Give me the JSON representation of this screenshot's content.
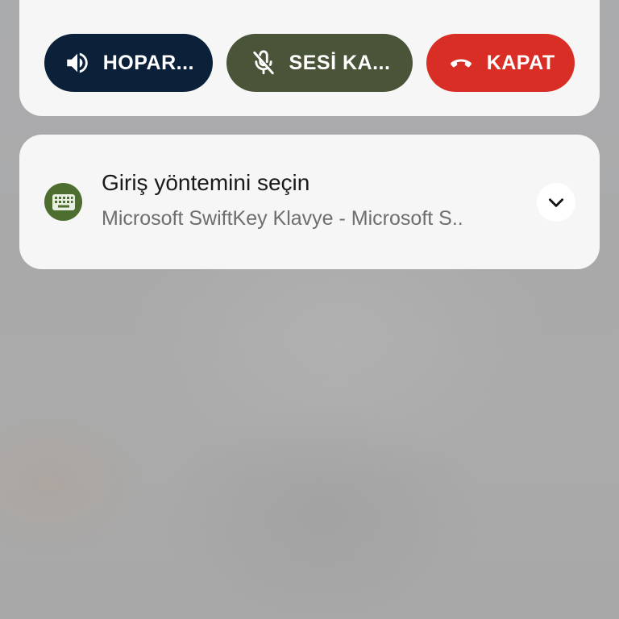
{
  "call_card": {
    "speaker_label": "HOPAR...",
    "speaker_icon": "speaker-icon",
    "mute_label": "SESİ KA...",
    "mute_icon": "mic-off-icon",
    "hangup_label": "KAPAT",
    "hangup_icon": "phone-hangup-icon",
    "colors": {
      "speaker_bg": "#0b2139",
      "mute_bg": "#4a5439",
      "hangup_bg": "#d92e26"
    }
  },
  "notification": {
    "app_icon": "keyboard-icon",
    "title": "Giriş yöntemini seçin",
    "subtitle": "Microsoft SwiftKey Klavye - Microsoft S..",
    "expand_icon": "chevron-down-icon",
    "colors": {
      "app_icon_bg": "#4d6e2f"
    }
  }
}
